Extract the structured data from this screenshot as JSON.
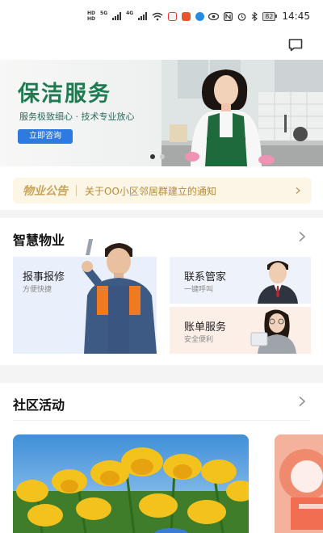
{
  "status_bar": {
    "hd_labels": [
      "HD",
      "HD"
    ],
    "network_1": "5G",
    "network_2": "4G",
    "battery": "82",
    "time": "14:45"
  },
  "header": {
    "message_icon": "message-icon"
  },
  "banner": {
    "title": "保洁服务",
    "subtitle": "服务极致细心 · 技术专业放心",
    "cta": "立即咨询",
    "dots": 2,
    "active_dot": 0
  },
  "notice": {
    "tag": "物业公告",
    "text": "关于OO小区邻居群建立的通知"
  },
  "smart_property": {
    "title": "智慧物业",
    "services": [
      {
        "name": "报事报修",
        "desc": "方便快捷"
      },
      {
        "name": "联系管家",
        "desc": "一键呼叫"
      },
      {
        "name": "账单服务",
        "desc": "安全便利"
      }
    ]
  },
  "community": {
    "title": "社区活动"
  },
  "colors": {
    "brand_green": "#1f7a52",
    "button_blue": "#2d7be0",
    "notice_gold": "#c9a35a"
  }
}
